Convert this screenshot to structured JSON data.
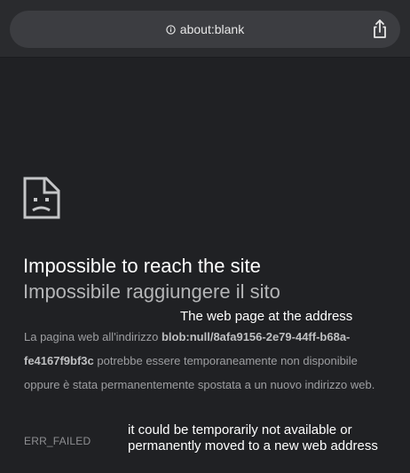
{
  "browser": {
    "address": "about:blank",
    "icons": {
      "info": "info-icon",
      "share": "share-icon"
    }
  },
  "error_page": {
    "icon": "broken-document-icon",
    "title_en": "Impossible to reach the site",
    "title_it": "Impossibile raggiungere il sito",
    "note_address": "The web page at the address",
    "body_prefix": "La pagina web all'indirizzo ",
    "blob_url": "blob:null/8afa9156-2e79-44ff-b68a-fe4167f9bf3c",
    "body_suffix": " potrebbe essere temporaneamente non disponibile oppure è stata permanentemente spostata a un nuovo indirizzo web.",
    "error_code": "ERR_FAILED",
    "note_unavailable": "it could be temporarily not available or permanently moved to a new web address"
  },
  "colors": {
    "background": "#202124",
    "toolbar": "#2a2b2e",
    "address_pill": "#3c3d41",
    "title_primary": "#ffffff",
    "title_secondary": "#b4b5b7",
    "body_text": "#9e9fa2"
  }
}
